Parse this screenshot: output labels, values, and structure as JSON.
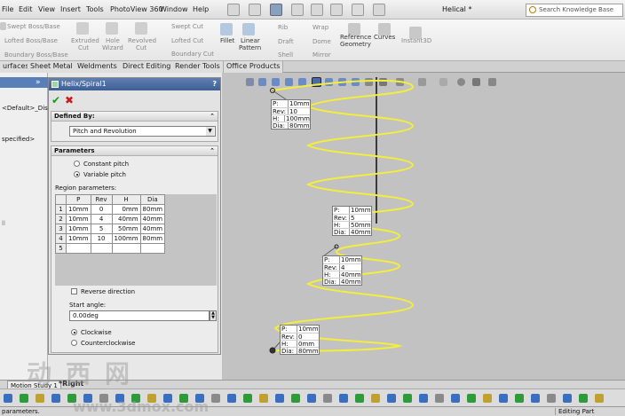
{
  "menu": [
    "File",
    "Edit",
    "View",
    "Insert",
    "Tools",
    "PhotoView 360",
    "Window",
    "Help"
  ],
  "document_title": "Helical *",
  "search": {
    "placeholder": "Search Knowledge Base"
  },
  "ribbon": {
    "left_commands": [
      "Swept Boss/Base",
      "Lofted Boss/Base",
      "Boundary Boss/Base"
    ],
    "extruded_cut": [
      "Extruded",
      "Cut"
    ],
    "hole_wizard": [
      "Hole",
      "Wizard"
    ],
    "revolved_cut": [
      "Revolved",
      "Cut"
    ],
    "cut_commands": [
      "Swept Cut",
      "Lofted Cut",
      "Boundary Cut"
    ],
    "fillet": "Fillet",
    "linear_pattern": [
      "Linear",
      "Pattern"
    ],
    "small_commands": [
      "Rib",
      "Draft",
      "Shell"
    ],
    "wrap_commands": [
      "Wrap",
      "Dome",
      "Mirror"
    ],
    "reference_geometry": [
      "Reference",
      "Geometry"
    ],
    "curves": "Curves",
    "instant3d": "Instant3D"
  },
  "tabs": [
    "urfaces",
    "Sheet Metal",
    "Weldments",
    "Direct Editing",
    "Render Tools",
    "Office Products"
  ],
  "left_panel": {
    "chevron": "»",
    "line1": "<Default>_Disp",
    "line2": "specified>",
    "line3": "ll"
  },
  "property_manager": {
    "title": "Helix/Spiral1",
    "help": "?",
    "ok_icon": "✔",
    "cancel_icon": "✖",
    "defined_by": {
      "header": "Defined By:",
      "value": "Pitch and Revolution"
    },
    "parameters": {
      "header": "Parameters",
      "constant_pitch": "Constant pitch",
      "variable_pitch": "Variable pitch",
      "region_label": "Region parameters:",
      "columns": [
        "P",
        "Rev",
        "H",
        "Dia"
      ],
      "rows": [
        {
          "n": "1",
          "p": "10mm",
          "rev": "0",
          "h": "0mm",
          "dia": "80mm"
        },
        {
          "n": "2",
          "p": "10mm",
          "rev": "4",
          "h": "40mm",
          "dia": "40mm"
        },
        {
          "n": "3",
          "p": "10mm",
          "rev": "5",
          "h": "50mm",
          "dia": "40mm"
        },
        {
          "n": "4",
          "p": "10mm",
          "rev": "10",
          "h": "100mm",
          "dia": "80mm"
        },
        {
          "n": "5",
          "p": "",
          "rev": "",
          "h": "",
          "dia": ""
        }
      ],
      "reverse_direction": "Reverse direction",
      "start_angle_label": "Start angle:",
      "start_angle_value": "0.00deg",
      "clockwise": "Clockwise",
      "counterclockwise": "Counterclockwise"
    }
  },
  "callouts": [
    {
      "p": "10mm",
      "rev": "10",
      "h": "100mm",
      "dia": "80mm"
    },
    {
      "p": "10mm",
      "rev": "5",
      "h": "50mm",
      "dia": "40mm"
    },
    {
      "p": "10mm",
      "rev": "4",
      "h": "40mm",
      "dia": "40mm"
    },
    {
      "p": "10mm",
      "rev": "0",
      "h": "0mm",
      "dia": "80mm"
    }
  ],
  "callout_keys": {
    "p": "P:",
    "rev": "Rev:",
    "h": "H:",
    "dia": "Dia:"
  },
  "motion": {
    "tab": "Motion Study 1",
    "view_label": "*Right"
  },
  "watermark": {
    "cn": "动西网",
    "url": "www.3dmox.com"
  },
  "status": {
    "left": "parameters.",
    "right": "Editing Part"
  },
  "colors": {
    "helix": "#f3ee3c",
    "title_bar": "#4a6ba4",
    "viewport": "#c2c2c2"
  }
}
